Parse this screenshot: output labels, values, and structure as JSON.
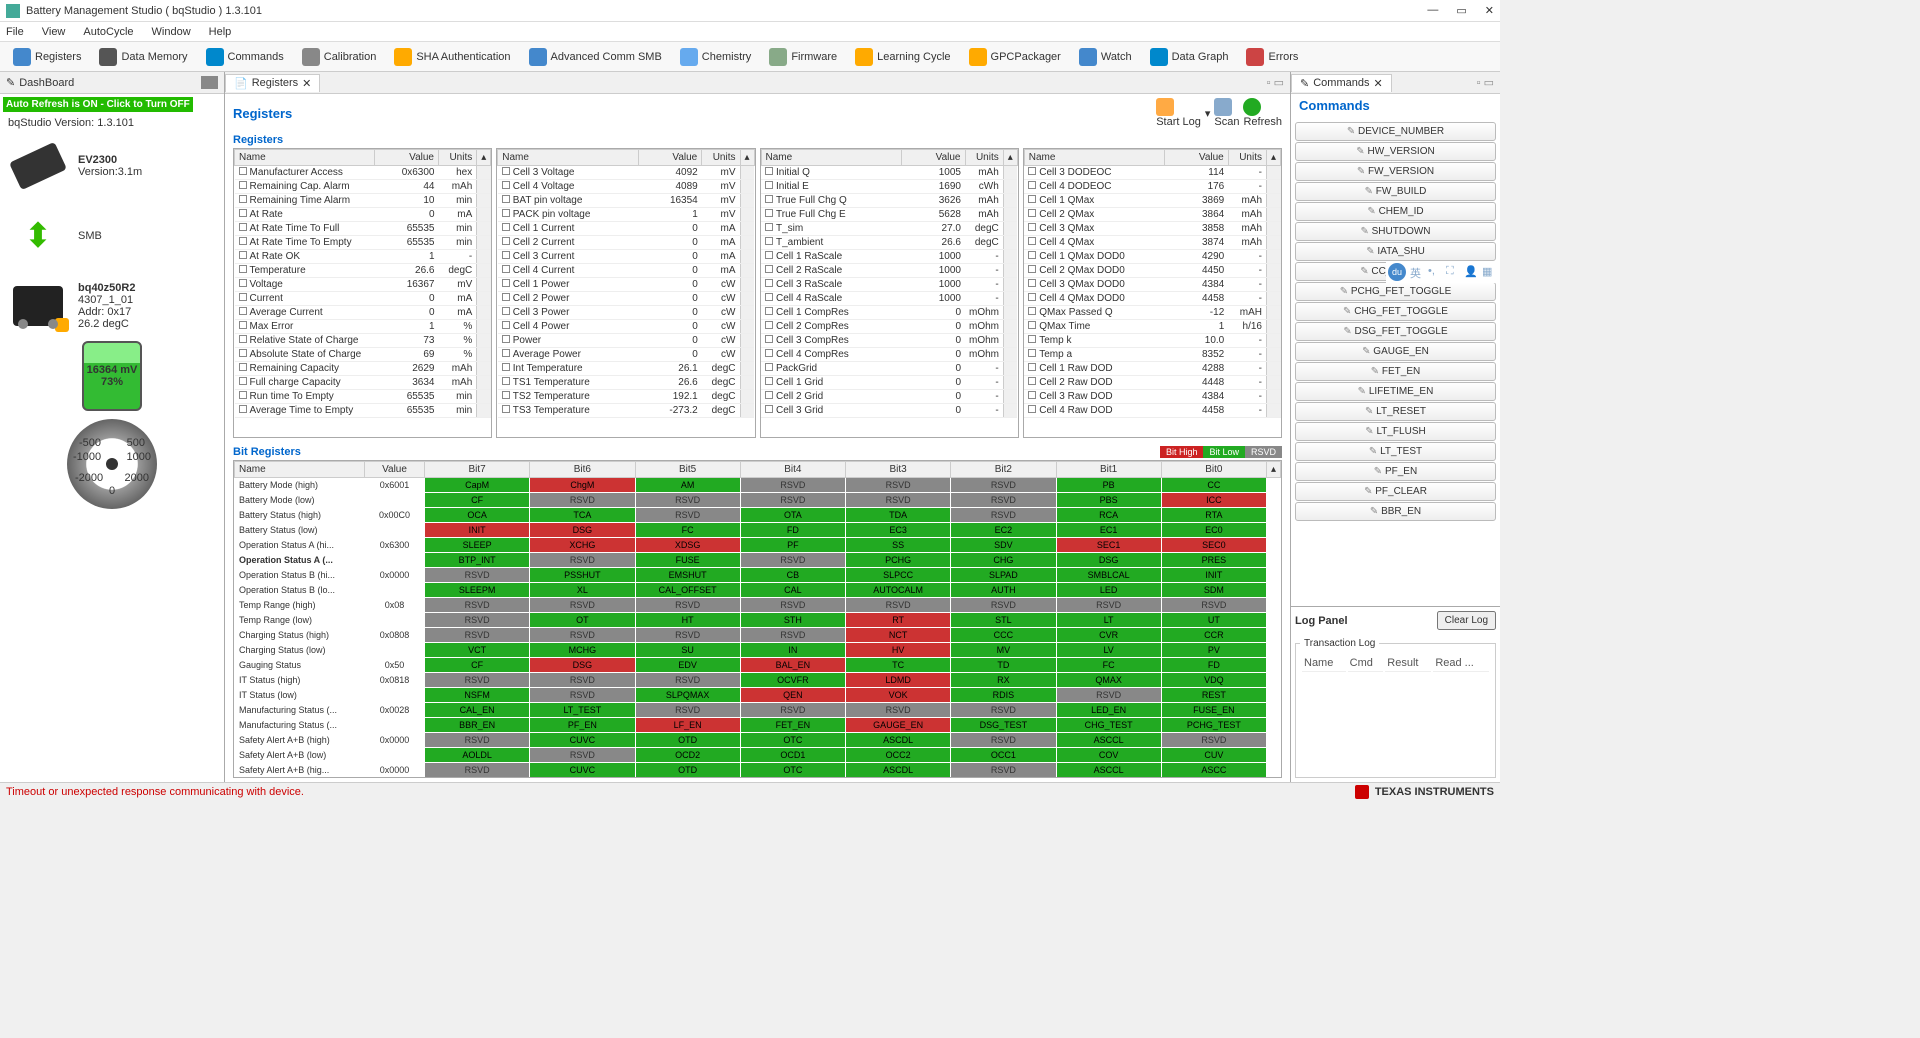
{
  "window": {
    "title": "Battery Management Studio ( bqStudio ) 1.3.101"
  },
  "menus": [
    "File",
    "View",
    "AutoCycle",
    "Window",
    "Help"
  ],
  "toolbar": [
    {
      "label": "Registers",
      "c": "#48c"
    },
    {
      "label": "Data Memory",
      "c": "#555"
    },
    {
      "label": "Commands",
      "c": "#08c"
    },
    {
      "label": "Calibration",
      "c": "#888"
    },
    {
      "label": "SHA Authentication",
      "c": "#fa0"
    },
    {
      "label": "Advanced Comm SMB",
      "c": "#48c"
    },
    {
      "label": "Chemistry",
      "c": "#6ae"
    },
    {
      "label": "Firmware",
      "c": "#8a8"
    },
    {
      "label": "Learning Cycle",
      "c": "#fa0"
    },
    {
      "label": "GPCPackager",
      "c": "#fa0"
    },
    {
      "label": "Watch",
      "c": "#48c"
    },
    {
      "label": "Data Graph",
      "c": "#08c"
    },
    {
      "label": "Errors",
      "c": "#c44"
    }
  ],
  "dashboard": {
    "tab": "DashBoard",
    "auto_refresh": "Auto Refresh is ON - Click to Turn OFF",
    "version": "bqStudio Version:  1.3.101",
    "adapter": {
      "name": "EV2300",
      "ver": "Version:3.1m"
    },
    "bus": "SMB",
    "chip": {
      "name": "bq40z50R2",
      "fw": "4307_1_01",
      "addr": "Addr: 0x17",
      "temp": "26.2 degC"
    },
    "battery": {
      "mv": "16364 mV",
      "pct": "73%"
    }
  },
  "reg_tab": "Registers",
  "panel": {
    "title": "Registers",
    "actions": {
      "start": "Start Log",
      "scan": "Scan",
      "refresh": "Refresh"
    }
  },
  "reg_section": "Registers",
  "grid_hdr": {
    "name": "Name",
    "value": "Value",
    "units": "Units"
  },
  "grid1": [
    [
      "Manufacturer Access",
      "0x6300",
      "hex"
    ],
    [
      "Remaining Cap. Alarm",
      "44",
      "mAh"
    ],
    [
      "Remaining Time Alarm",
      "10",
      "min"
    ],
    [
      "At Rate",
      "0",
      "mA"
    ],
    [
      "At Rate Time To Full",
      "65535",
      "min"
    ],
    [
      "At Rate Time To Empty",
      "65535",
      "min"
    ],
    [
      "At Rate OK",
      "1",
      "-"
    ],
    [
      "Temperature",
      "26.6",
      "degC"
    ],
    [
      "Voltage",
      "16367",
      "mV"
    ],
    [
      "Current",
      "0",
      "mA"
    ],
    [
      "Average Current",
      "0",
      "mA"
    ],
    [
      "Max Error",
      "1",
      "%"
    ],
    [
      "Relative State of Charge",
      "73",
      "%"
    ],
    [
      "Absolute State of Charge",
      "69",
      "%"
    ],
    [
      "Remaining Capacity",
      "2629",
      "mAh"
    ],
    [
      "Full charge Capacity",
      "3634",
      "mAh"
    ],
    [
      "Run time To Empty",
      "65535",
      "min"
    ],
    [
      "Average Time to Empty",
      "65535",
      "min"
    ]
  ],
  "grid2": [
    [
      "Cell 3 Voltage",
      "4092",
      "mV"
    ],
    [
      "Cell 4 Voltage",
      "4089",
      "mV"
    ],
    [
      "BAT pin voltage",
      "16354",
      "mV"
    ],
    [
      "PACK pin voltage",
      "1",
      "mV"
    ],
    [
      "Cell 1 Current",
      "0",
      "mA"
    ],
    [
      "Cell 2 Current",
      "0",
      "mA"
    ],
    [
      "Cell 3 Current",
      "0",
      "mA"
    ],
    [
      "Cell 4 Current",
      "0",
      "mA"
    ],
    [
      "Cell 1 Power",
      "0",
      "cW"
    ],
    [
      "Cell 2 Power",
      "0",
      "cW"
    ],
    [
      "Cell 3 Power",
      "0",
      "cW"
    ],
    [
      "Cell 4 Power",
      "0",
      "cW"
    ],
    [
      "Power",
      "0",
      "cW"
    ],
    [
      "Average Power",
      "0",
      "cW"
    ],
    [
      "Int Temperature",
      "26.1",
      "degC"
    ],
    [
      "TS1 Temperature",
      "26.6",
      "degC"
    ],
    [
      "TS2 Temperature",
      "192.1",
      "degC"
    ],
    [
      "TS3 Temperature",
      "-273.2",
      "degC"
    ]
  ],
  "grid3": [
    [
      "Initial Q",
      "1005",
      "mAh"
    ],
    [
      "Initial E",
      "1690",
      "cWh"
    ],
    [
      "True Full Chg Q",
      "3626",
      "mAh"
    ],
    [
      "True Full Chg E",
      "5628",
      "mAh"
    ],
    [
      "T_sim",
      "27.0",
      "degC"
    ],
    [
      "T_ambient",
      "26.6",
      "degC"
    ],
    [
      "Cell 1 RaScale",
      "1000",
      "-"
    ],
    [
      "Cell 2 RaScale",
      "1000",
      "-"
    ],
    [
      "Cell 3 RaScale",
      "1000",
      "-"
    ],
    [
      "Cell 4 RaScale",
      "1000",
      "-"
    ],
    [
      "Cell 1 CompRes",
      "0",
      "mOhm"
    ],
    [
      "Cell 2 CompRes",
      "0",
      "mOhm"
    ],
    [
      "Cell 3 CompRes",
      "0",
      "mOhm"
    ],
    [
      "Cell 4 CompRes",
      "0",
      "mOhm"
    ],
    [
      "PackGrid",
      "0",
      "-"
    ],
    [
      "Cell 1 Grid",
      "0",
      "-"
    ],
    [
      "Cell 2 Grid",
      "0",
      "-"
    ],
    [
      "Cell 3 Grid",
      "0",
      "-"
    ]
  ],
  "grid4": [
    [
      "Cell 3 DODEOC",
      "114",
      "-"
    ],
    [
      "Cell 4 DODEOC",
      "176",
      "-"
    ],
    [
      "Cell 1 QMax",
      "3869",
      "mAh"
    ],
    [
      "Cell 2 QMax",
      "3864",
      "mAh"
    ],
    [
      "Cell 3 QMax",
      "3858",
      "mAh"
    ],
    [
      "Cell 4 QMax",
      "3874",
      "mAh"
    ],
    [
      "Cell 1 QMax DOD0",
      "4290",
      "-"
    ],
    [
      "Cell 2 QMax DOD0",
      "4450",
      "-"
    ],
    [
      "Cell 3 QMax DOD0",
      "4384",
      "-"
    ],
    [
      "Cell 4 QMax DOD0",
      "4458",
      "-"
    ],
    [
      "QMax Passed Q",
      "-12",
      "mAH"
    ],
    [
      "QMax Time",
      "1",
      "h/16"
    ],
    [
      "Temp k",
      "10.0",
      "-"
    ],
    [
      "Temp a",
      "8352",
      "-"
    ],
    [
      "Cell 1 Raw DOD",
      "4288",
      "-"
    ],
    [
      "Cell 2 Raw DOD",
      "4448",
      "-"
    ],
    [
      "Cell 3 Raw DOD",
      "4384",
      "-"
    ],
    [
      "Cell 4 Raw DOD",
      "4458",
      "-"
    ]
  ],
  "bit_section": "Bit Registers",
  "bit_legend": {
    "high": "Bit High",
    "low": "Bit Low",
    "rsvd": "RSVD"
  },
  "bit_hdr": [
    "Name",
    "Value",
    "Bit7",
    "Bit6",
    "Bit5",
    "Bit4",
    "Bit3",
    "Bit2",
    "Bit1",
    "Bit0"
  ],
  "bits": [
    {
      "n": "Battery Mode (high)",
      "v": "0x6001",
      "c": [
        [
          "CapM",
          "g"
        ],
        [
          "ChgM",
          "r"
        ],
        [
          "AM",
          "g"
        ],
        [
          "RSVD",
          "x"
        ],
        [
          "RSVD",
          "x"
        ],
        [
          "RSVD",
          "x"
        ],
        [
          "PB",
          "g"
        ],
        [
          "CC",
          "g"
        ]
      ]
    },
    {
      "n": "Battery Mode (low)",
      "v": "",
      "c": [
        [
          "CF",
          "g"
        ],
        [
          "RSVD",
          "x"
        ],
        [
          "RSVD",
          "x"
        ],
        [
          "RSVD",
          "x"
        ],
        [
          "RSVD",
          "x"
        ],
        [
          "RSVD",
          "x"
        ],
        [
          "PBS",
          "g"
        ],
        [
          "ICC",
          "r"
        ]
      ]
    },
    {
      "n": "Battery Status (high)",
      "v": "0x00C0",
      "c": [
        [
          "OCA",
          "g"
        ],
        [
          "TCA",
          "g"
        ],
        [
          "RSVD",
          "x"
        ],
        [
          "OTA",
          "g"
        ],
        [
          "TDA",
          "g"
        ],
        [
          "RSVD",
          "x"
        ],
        [
          "RCA",
          "g"
        ],
        [
          "RTA",
          "g"
        ]
      ]
    },
    {
      "n": "Battery Status (low)",
      "v": "",
      "c": [
        [
          "INIT",
          "r"
        ],
        [
          "DSG",
          "r"
        ],
        [
          "FC",
          "g"
        ],
        [
          "FD",
          "g"
        ],
        [
          "EC3",
          "g"
        ],
        [
          "EC2",
          "g"
        ],
        [
          "EC1",
          "g"
        ],
        [
          "EC0",
          "g"
        ]
      ]
    },
    {
      "n": "Operation Status A (hi...",
      "v": "0x6300",
      "c": [
        [
          "SLEEP",
          "g"
        ],
        [
          "XCHG",
          "r"
        ],
        [
          "XDSG",
          "r"
        ],
        [
          "PF",
          "g"
        ],
        [
          "SS",
          "g"
        ],
        [
          "SDV",
          "g"
        ],
        [
          "SEC1",
          "r"
        ],
        [
          "SEC0",
          "r"
        ]
      ]
    },
    {
      "n": "Operation Status A (...",
      "v": "",
      "b": true,
      "c": [
        [
          "BTP_INT",
          "g"
        ],
        [
          "RSVD",
          "x"
        ],
        [
          "FUSE",
          "g"
        ],
        [
          "RSVD",
          "x"
        ],
        [
          "PCHG",
          "g"
        ],
        [
          "CHG",
          "g"
        ],
        [
          "DSG",
          "g"
        ],
        [
          "PRES",
          "g"
        ]
      ]
    },
    {
      "n": "Operation Status B (hi...",
      "v": "0x0000",
      "c": [
        [
          "RSVD",
          "x"
        ],
        [
          "PSSHUT",
          "g"
        ],
        [
          "EMSHUT",
          "g"
        ],
        [
          "CB",
          "g"
        ],
        [
          "SLPCC",
          "g"
        ],
        [
          "SLPAD",
          "g"
        ],
        [
          "SMBLCAL",
          "g"
        ],
        [
          "INIT",
          "g"
        ]
      ]
    },
    {
      "n": "Operation Status B (lo...",
      "v": "",
      "c": [
        [
          "SLEEPM",
          "g"
        ],
        [
          "XL",
          "g"
        ],
        [
          "CAL_OFFSET",
          "g"
        ],
        [
          "CAL",
          "g"
        ],
        [
          "AUTOCALM",
          "g"
        ],
        [
          "AUTH",
          "g"
        ],
        [
          "LED",
          "g"
        ],
        [
          "SDM",
          "g"
        ]
      ]
    },
    {
      "n": "Temp Range (high)",
      "v": "0x08",
      "c": [
        [
          "RSVD",
          "x"
        ],
        [
          "RSVD",
          "x"
        ],
        [
          "RSVD",
          "x"
        ],
        [
          "RSVD",
          "x"
        ],
        [
          "RSVD",
          "x"
        ],
        [
          "RSVD",
          "x"
        ],
        [
          "RSVD",
          "x"
        ],
        [
          "RSVD",
          "x"
        ]
      ]
    },
    {
      "n": "Temp Range (low)",
      "v": "",
      "c": [
        [
          "RSVD",
          "x"
        ],
        [
          "OT",
          "g"
        ],
        [
          "HT",
          "g"
        ],
        [
          "STH",
          "g"
        ],
        [
          "RT",
          "r"
        ],
        [
          "STL",
          "g"
        ],
        [
          "LT",
          "g"
        ],
        [
          "UT",
          "g"
        ]
      ]
    },
    {
      "n": "Charging Status (high)",
      "v": "0x0808",
      "c": [
        [
          "RSVD",
          "x"
        ],
        [
          "RSVD",
          "x"
        ],
        [
          "RSVD",
          "x"
        ],
        [
          "RSVD",
          "x"
        ],
        [
          "NCT",
          "r"
        ],
        [
          "CCC",
          "g"
        ],
        [
          "CVR",
          "g"
        ],
        [
          "CCR",
          "g"
        ]
      ]
    },
    {
      "n": "Charging Status (low)",
      "v": "",
      "c": [
        [
          "VCT",
          "g"
        ],
        [
          "MCHG",
          "g"
        ],
        [
          "SU",
          "g"
        ],
        [
          "IN",
          "g"
        ],
        [
          "HV",
          "r"
        ],
        [
          "MV",
          "g"
        ],
        [
          "LV",
          "g"
        ],
        [
          "PV",
          "g"
        ]
      ]
    },
    {
      "n": "Gauging Status",
      "v": "0x50",
      "c": [
        [
          "CF",
          "g"
        ],
        [
          "DSG",
          "r"
        ],
        [
          "EDV",
          "g"
        ],
        [
          "BAL_EN",
          "r"
        ],
        [
          "TC",
          "g"
        ],
        [
          "TD",
          "g"
        ],
        [
          "FC",
          "g"
        ],
        [
          "FD",
          "g"
        ]
      ]
    },
    {
      "n": "IT Status (high)",
      "v": "0x0818",
      "c": [
        [
          "RSVD",
          "x"
        ],
        [
          "RSVD",
          "x"
        ],
        [
          "RSVD",
          "x"
        ],
        [
          "OCVFR",
          "g"
        ],
        [
          "LDMD",
          "r"
        ],
        [
          "RX",
          "g"
        ],
        [
          "QMAX",
          "g"
        ],
        [
          "VDQ",
          "g"
        ]
      ]
    },
    {
      "n": "IT Status (low)",
      "v": "",
      "c": [
        [
          "NSFM",
          "g"
        ],
        [
          "RSVD",
          "x"
        ],
        [
          "SLPQMAX",
          "g"
        ],
        [
          "QEN",
          "r"
        ],
        [
          "VOK",
          "r"
        ],
        [
          "RDIS",
          "g"
        ],
        [
          "RSVD",
          "x"
        ],
        [
          "REST",
          "g"
        ]
      ]
    },
    {
      "n": "Manufacturing Status (...",
      "v": "0x0028",
      "c": [
        [
          "CAL_EN",
          "g"
        ],
        [
          "LT_TEST",
          "g"
        ],
        [
          "RSVD",
          "x"
        ],
        [
          "RSVD",
          "x"
        ],
        [
          "RSVD",
          "x"
        ],
        [
          "RSVD",
          "x"
        ],
        [
          "LED_EN",
          "g"
        ],
        [
          "FUSE_EN",
          "g"
        ]
      ]
    },
    {
      "n": "Manufacturing Status (...",
      "v": "",
      "c": [
        [
          "BBR_EN",
          "g"
        ],
        [
          "PF_EN",
          "g"
        ],
        [
          "LF_EN",
          "r"
        ],
        [
          "FET_EN",
          "g"
        ],
        [
          "GAUGE_EN",
          "r"
        ],
        [
          "DSG_TEST",
          "g"
        ],
        [
          "CHG_TEST",
          "g"
        ],
        [
          "PCHG_TEST",
          "g"
        ]
      ]
    },
    {
      "n": "Safety Alert A+B (high)",
      "v": "0x0000",
      "c": [
        [
          "RSVD",
          "x"
        ],
        [
          "CUVC",
          "g"
        ],
        [
          "OTD",
          "g"
        ],
        [
          "OTC",
          "g"
        ],
        [
          "ASCDL",
          "g"
        ],
        [
          "RSVD",
          "x"
        ],
        [
          "ASCCL",
          "g"
        ],
        [
          "RSVD",
          "x"
        ]
      ]
    },
    {
      "n": "Safety Alert A+B (low)",
      "v": "",
      "c": [
        [
          "AOLDL",
          "g"
        ],
        [
          "RSVD",
          "x"
        ],
        [
          "OCD2",
          "g"
        ],
        [
          "OCD1",
          "g"
        ],
        [
          "OCC2",
          "g"
        ],
        [
          "OCC1",
          "g"
        ],
        [
          "COV",
          "g"
        ],
        [
          "CUV",
          "g"
        ]
      ]
    },
    {
      "n": "Safety Alert A+B (hig...",
      "v": "0x0000",
      "c": [
        [
          "RSVD",
          "x"
        ],
        [
          "CUVC",
          "g"
        ],
        [
          "OTD",
          "g"
        ],
        [
          "OTC",
          "g"
        ],
        [
          "ASCDL",
          "g"
        ],
        [
          "RSVD",
          "x"
        ],
        [
          "ASCCL",
          "g"
        ],
        [
          "ASCC",
          "g"
        ]
      ]
    }
  ],
  "cmd_tab": "Commands",
  "cmd_title": "Commands",
  "cmds": [
    "DEVICE_NUMBER",
    "HW_VERSION",
    "FW_VERSION",
    "FW_BUILD",
    "CHEM_ID",
    "SHUTDOWN",
    "IATA_SHU",
    "CC_OFFSET",
    "PCHG_FET_TOGGLE",
    "CHG_FET_TOGGLE",
    "DSG_FET_TOGGLE",
    "GAUGE_EN",
    "FET_EN",
    "LIFETIME_EN",
    "LT_RESET",
    "LT_FLUSH",
    "LT_TEST",
    "PF_EN",
    "PF_CLEAR",
    "BBR_EN"
  ],
  "log": {
    "title": "Log Panel",
    "clear": "Clear Log",
    "legend": "Transaction Log",
    "cols": [
      "Name",
      "Cmd",
      "Result",
      "Read ..."
    ]
  },
  "status": {
    "err": "Timeout or unexpected response communicating with device.",
    "ti": "TEXAS INSTRUMENTS"
  }
}
